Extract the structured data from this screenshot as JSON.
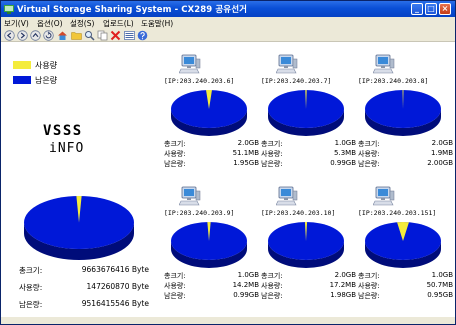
{
  "window": {
    "title": "Virtual Storage Sharing System - CX289 공유선거"
  },
  "menu": {
    "items": [
      {
        "label": "보기(V)"
      },
      {
        "label": "옵션(O)"
      },
      {
        "label": "설정(S)"
      },
      {
        "label": "업로드(L)"
      },
      {
        "label": "도움말(H)"
      }
    ]
  },
  "legend": {
    "used_label": "사용량",
    "free_label": "남은량",
    "used_color": "#f4ec3c",
    "free_color": "#0018d8"
  },
  "branding": {
    "line1": "VSSS",
    "line2": "iNFO"
  },
  "labels": {
    "total": "총크기:",
    "used": "사용량:",
    "free": "남은량:"
  },
  "total": {
    "total_size": "9663676416 Byte",
    "used": "147260870 Byte",
    "free": "9516415546 Byte",
    "used_fraction": 0.0152
  },
  "clients": [
    {
      "ip": "[IP:203.240.203.6]",
      "total": "2.0GB",
      "used": "51.1MB",
      "free": "1.95GB",
      "used_fraction": 0.025
    },
    {
      "ip": "[IP:203.240.203.7]",
      "total": "1.0GB",
      "used": "5.3MB",
      "free": "0.99GB",
      "used_fraction": 0.006
    },
    {
      "ip": "[IP:203.240.203.8]",
      "total": "2.0GB",
      "used": "1.9MB",
      "free": "2.00GB",
      "used_fraction": 0.002
    },
    {
      "ip": "[IP:203.240.203.9]",
      "total": "1.0GB",
      "used": "14.2MB",
      "free": "0.99GB",
      "used_fraction": 0.014
    },
    {
      "ip": "[IP:203.240.203.10]",
      "total": "2.0GB",
      "used": "17.2MB",
      "free": "1.98GB",
      "used_fraction": 0.009
    },
    {
      "ip": "[IP:203.240.203.151]",
      "total": "1.0GB",
      "used": "50.7MB",
      "free": "0.95GB",
      "used_fraction": 0.05
    }
  ],
  "icons": {
    "toolbar": [
      "back-icon",
      "forward-icon",
      "up-icon",
      "refresh-icon",
      "home-icon",
      "folder-icon",
      "search-icon",
      "copy-icon",
      "delete-icon",
      "view-icon",
      "help-icon"
    ],
    "client": "computer-icon"
  }
}
